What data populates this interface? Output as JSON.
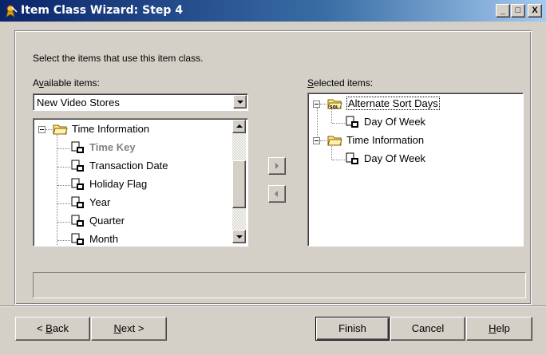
{
  "window": {
    "title": "Item Class Wizard: Step 4",
    "title_icon": "wizard-icon",
    "minimize_label": "_",
    "maximize_label": "□",
    "close_label": "X"
  },
  "instruction": "Select the items that use this item class.",
  "available": {
    "label_prefix": "A",
    "label_accel": "v",
    "label_rest": "ailable items:",
    "table_selected": "New Video Stores",
    "tree": [
      {
        "label": "Time Information",
        "type": "folder",
        "expanded": true
      },
      {
        "label": "Time Key",
        "type": "item",
        "disabled": true
      },
      {
        "label": "Transaction Date",
        "type": "item"
      },
      {
        "label": "Holiday Flag",
        "type": "item"
      },
      {
        "label": "Year",
        "type": "item"
      },
      {
        "label": "Quarter",
        "type": "item"
      },
      {
        "label": "Month",
        "type": "item"
      }
    ]
  },
  "selected": {
    "label_accel": "S",
    "label_rest": "elected items:",
    "tree": [
      {
        "label": "Alternate Sort Days",
        "type": "sql-folder",
        "expanded": true,
        "focused": true
      },
      {
        "label": "Day Of Week",
        "type": "item"
      },
      {
        "label": "Time Information",
        "type": "folder",
        "expanded": true
      },
      {
        "label": "Day Of Week",
        "type": "item"
      }
    ]
  },
  "move_buttons": {
    "add_icon": "arrow-right-icon",
    "remove_icon": "arrow-left-icon"
  },
  "buttons": {
    "back_prefix": "< ",
    "back_accel": "B",
    "back_rest": "ack",
    "next_accel": "N",
    "next_rest": "ext >",
    "finish": "Finish",
    "cancel": "Cancel",
    "help_accel": "H",
    "help_rest": "elp"
  },
  "colors": {
    "title_gradient_start": "#0a246a",
    "title_gradient_end": "#a6caf0",
    "disabled_text": "#808080",
    "folder_yellow": "#ffe680"
  }
}
